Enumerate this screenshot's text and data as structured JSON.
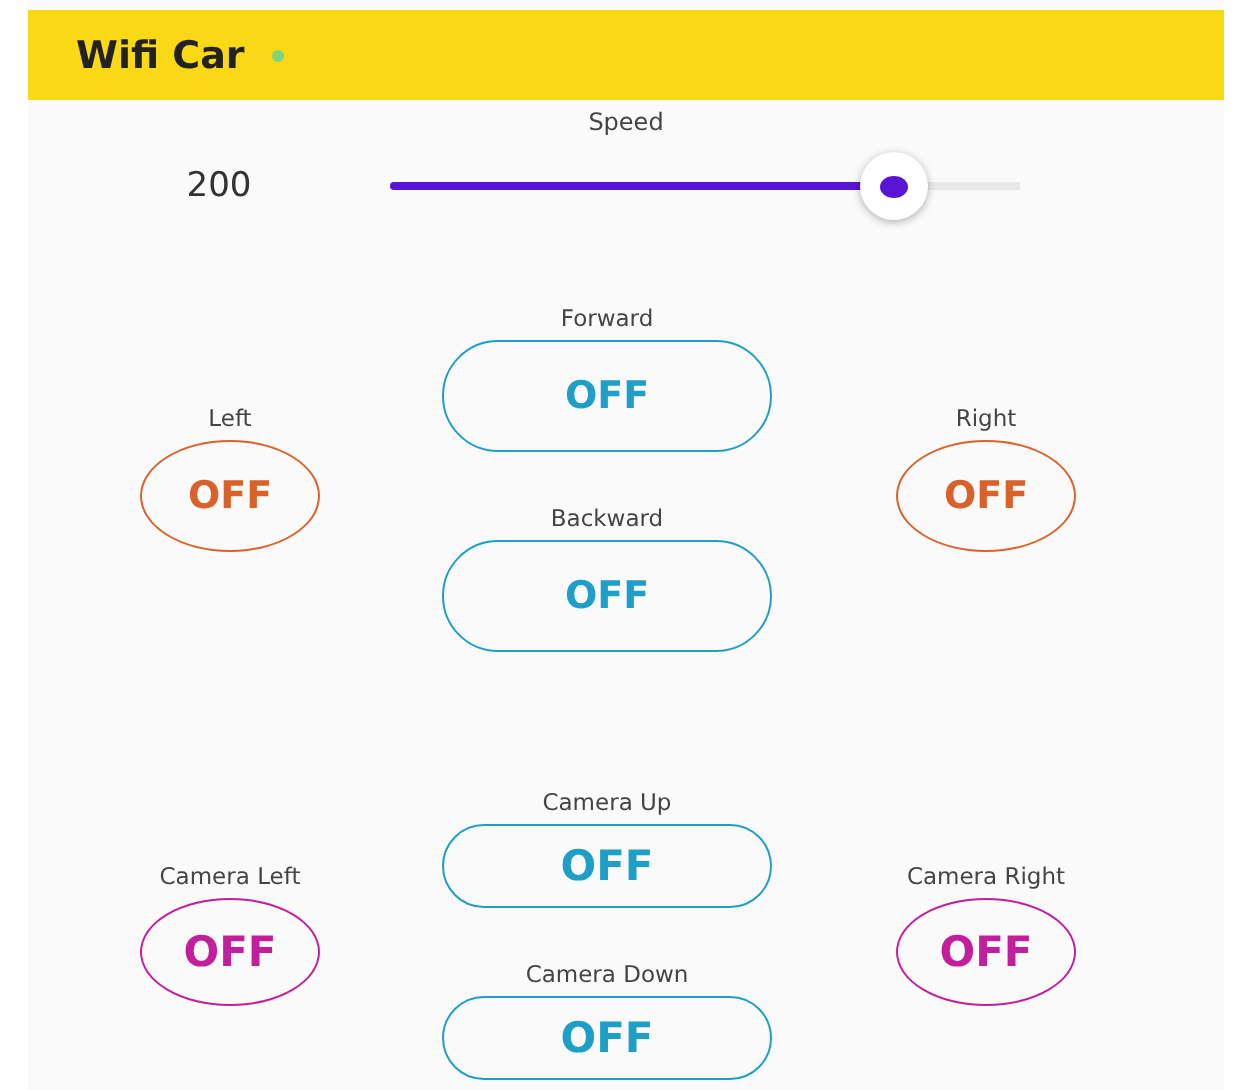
{
  "app_bar": {
    "title": "Wifi Car"
  },
  "speed": {
    "label": "Speed",
    "value": "200",
    "level": 0.8
  },
  "groups": [
    {
      "left": {
        "label": "Left",
        "text": "OFF",
        "on": false,
        "color": "#d9622b"
      },
      "center": [
        {
          "label": "Forward",
          "text": "OFF",
          "on": false,
          "color": "#1f9fc8"
        },
        {
          "label": "Backward",
          "text": "OFF",
          "on": false,
          "color": "#1f9fc8"
        }
      ],
      "right": {
        "label": "Right",
        "text": "OFF",
        "on": false,
        "color": "#d9622b"
      }
    },
    {
      "left": {
        "label": "Camera Left",
        "text": "OFF",
        "on": false,
        "color": "#c21f9c"
      },
      "center": [
        {
          "label": "Camera Up",
          "text": "OFF",
          "on": false,
          "color": "#1f9fc8"
        },
        {
          "label": "Camera Down",
          "text": "OFF",
          "on": false,
          "color": "#1f9fc8"
        }
      ],
      "right": {
        "label": "Camera Right",
        "text": "OFF",
        "on": false,
        "color": "#c21f9c"
      }
    }
  ]
}
